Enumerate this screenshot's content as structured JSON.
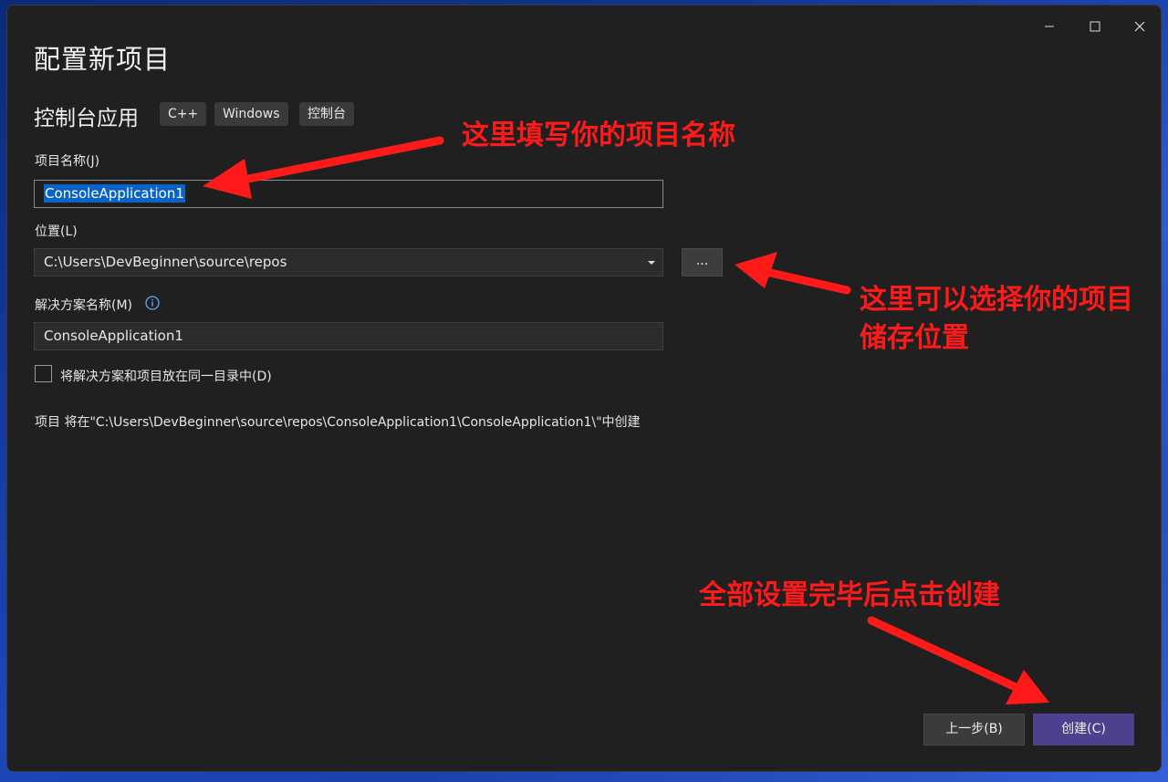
{
  "window": {
    "title": "配置新项目",
    "controls": {
      "minimize": "minimize-icon",
      "maximize": "maximize-icon",
      "close": "close-icon"
    }
  },
  "template": {
    "name": "控制台应用",
    "tags": [
      "C++",
      "Windows",
      "控制台"
    ]
  },
  "form": {
    "project_name_label": "项目名称(J)",
    "project_name_value": "ConsoleApplication1",
    "location_label": "位置(L)",
    "location_value": "C:\\Users\\DevBeginner\\source\\repos",
    "browse_label": "...",
    "solution_name_label": "解决方案名称(M)",
    "solution_name_value": "ConsoleApplication1",
    "same_dir_checkbox_label": "将解决方案和项目放在同一目录中(D)",
    "same_dir_checked": false,
    "note": "项目 将在\"C:\\Users\\DevBeginner\\source\\repos\\ConsoleApplication1\\ConsoleApplication1\\\"中创建"
  },
  "buttons": {
    "back": "上一步(B)",
    "create": "创建(C)"
  },
  "annotations": {
    "name_hint": "这里填写你的项目名称",
    "location_hint_line1": "这里可以选择你的项目",
    "location_hint_line2": "储存位置",
    "create_hint": "全部设置完毕后点击创建",
    "color": "#ff1a1a"
  },
  "colors": {
    "window_bg": "#202020",
    "create_button": "#4e3f8f",
    "selection": "#0a64c8"
  }
}
